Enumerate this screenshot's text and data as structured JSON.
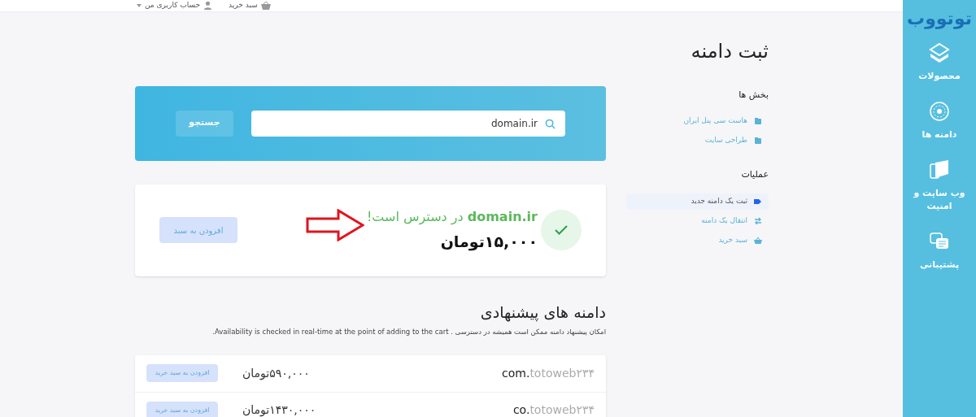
{
  "top_bar": {
    "cart": "سبد خرید",
    "account": "حساب کاربری من"
  },
  "nav": {
    "logo": "توتووب",
    "items": [
      {
        "kind": "products",
        "label": "محصولات"
      },
      {
        "kind": "domains",
        "label": "دامنه ها"
      },
      {
        "kind": "security",
        "label": "وب سایت و امنیت"
      },
      {
        "kind": "support",
        "label": "پشتیبانی"
      }
    ]
  },
  "page_title": "ثبت دامنه",
  "sidebar": {
    "sections": [
      {
        "title": "بخش ها",
        "items": [
          {
            "kind": "folder",
            "label": "هاست سی پنل ایران",
            "selected": false
          },
          {
            "kind": "folder",
            "label": "طراحی سایت",
            "selected": false
          }
        ]
      },
      {
        "title": "عملیات",
        "items": [
          {
            "kind": "tag",
            "label": "ثبت یک دامنه جدید",
            "selected": true
          },
          {
            "kind": "transfer",
            "label": "انتقال یک دامنه",
            "selected": false
          },
          {
            "kind": "basket",
            "label": "سبد خرید",
            "selected": false
          }
        ]
      }
    ]
  },
  "search": {
    "value": "domain.ir",
    "button": "جستجو"
  },
  "result": {
    "message": "**domain.ir** در دسترس است!",
    "price": "۱۵,۰۰۰تومان",
    "button": "افزودن به سبد"
  },
  "suggestions": {
    "title": "دامنه های پیشنهادی",
    "note": "امکان پیشنهاد دامنه ممکن است همیشه در دسترسی . Availability is checked in real-time at the point of adding to the cart.",
    "rows": [
      {
        "sld": "totoweb۲۳۴",
        "tld": "com.",
        "price": "۵۹۰,۰۰۰تومان",
        "button": "افزودن به سبد خرید"
      },
      {
        "sld": "totoweb۲۳۴",
        "tld": "co.",
        "price": "۱۴۳۰,۰۰۰تومان",
        "button": "افزودن به سبد خرید"
      }
    ]
  }
}
